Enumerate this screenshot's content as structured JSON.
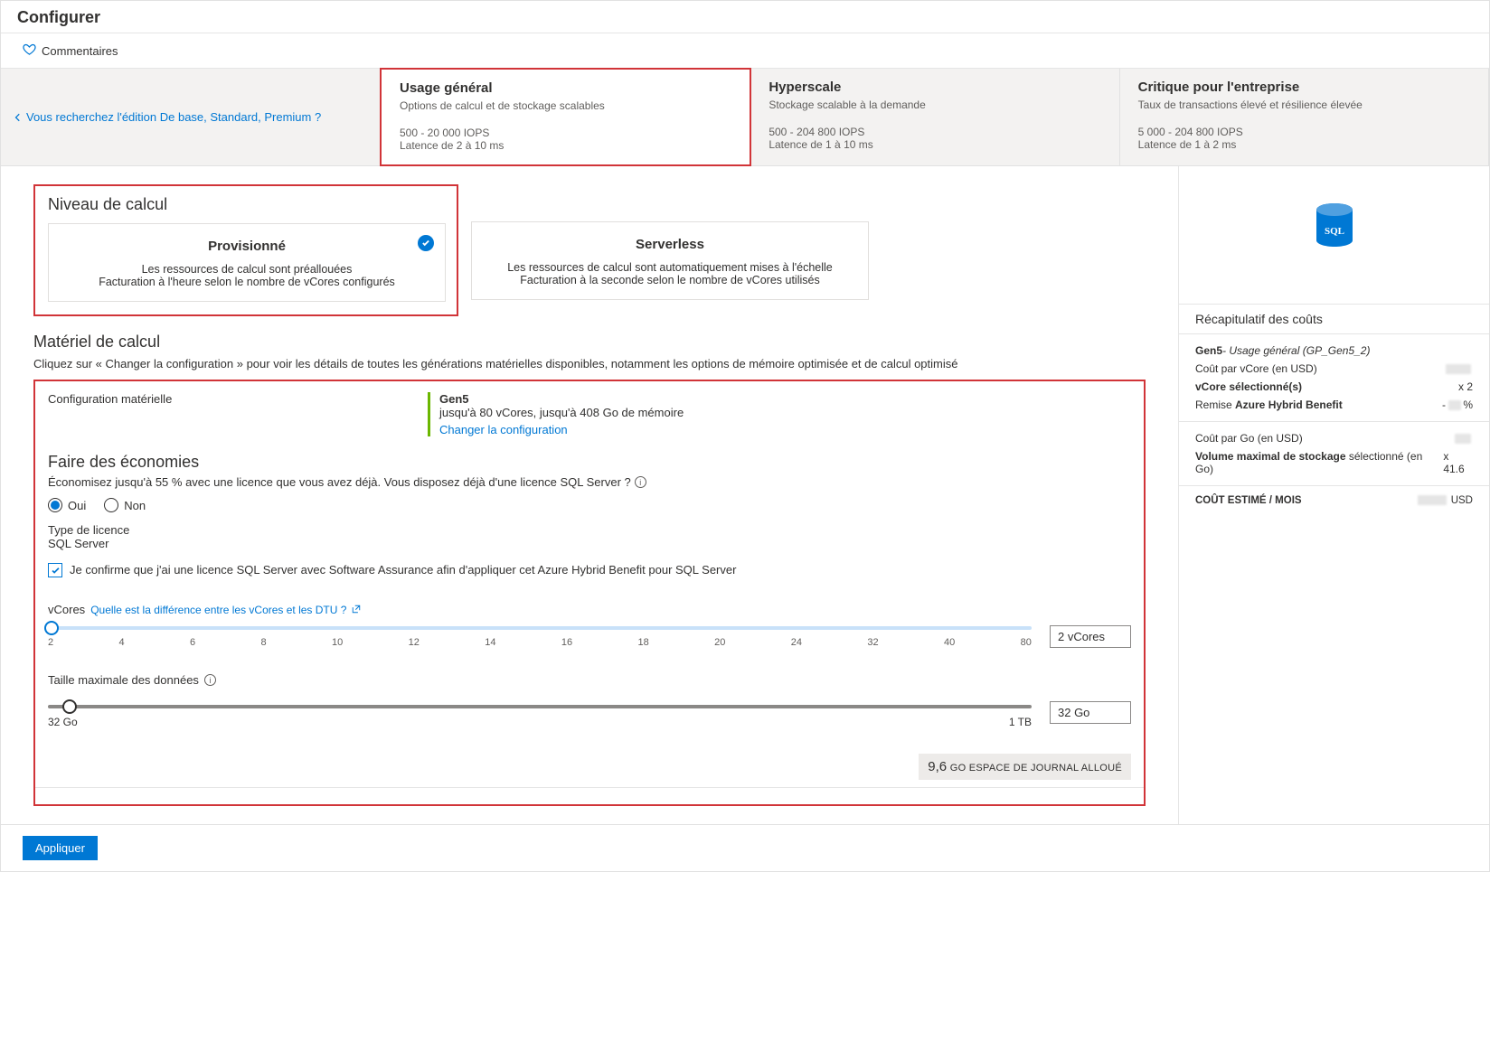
{
  "header": {
    "title": "Configurer"
  },
  "feedback": {
    "label": "Commentaires"
  },
  "back_link": "Vous recherchez l'édition De base, Standard, Premium ?",
  "tiers": {
    "general": {
      "title": "Usage général",
      "sub": "Options de calcul et de stockage scalables",
      "iops": "500 - 20 000 IOPS",
      "latency": "Latence de 2 à 10 ms"
    },
    "hyperscale": {
      "title": "Hyperscale",
      "sub": "Stockage scalable à la demande",
      "iops": "500 - 204 800 IOPS",
      "latency": "Latence de 1 à 10 ms"
    },
    "critical": {
      "title": "Critique pour l'entreprise",
      "sub": "Taux de transactions élevé et résilience élevée",
      "iops": "5 000 - 204 800 IOPS",
      "latency": "Latence de 1 à 2 ms"
    }
  },
  "compute_tier": {
    "section_title": "Niveau de calcul",
    "provisioned": {
      "title": "Provisionné",
      "line1": "Les ressources de calcul sont préallouées",
      "line2": "Facturation à l'heure selon le nombre de vCores configurés"
    },
    "serverless": {
      "title": "Serverless",
      "line1": "Les ressources de calcul sont automatiquement mises à l'échelle",
      "line2": "Facturation à la seconde selon le nombre de vCores utilisés"
    }
  },
  "hardware": {
    "section_title": "Matériel de calcul",
    "para": "Cliquez sur « Changer la configuration » pour voir les détails de toutes les générations matérielles disponibles, notamment les options de mémoire optimisée et de calcul optimisé",
    "label": "Configuration matérielle",
    "name": "Gen5",
    "desc": "jusqu'à 80 vCores, jusqu'à 408 Go de mémoire",
    "change_link": "Changer la configuration"
  },
  "savings": {
    "title": "Faire des économies",
    "para": "Économisez jusqu'à 55 % avec une licence que vous avez déjà. Vous disposez déjà d'une licence SQL Server ?",
    "yes": "Oui",
    "no": "Non",
    "license_type_label": "Type de licence",
    "license_type_value": "SQL Server",
    "confirm": "Je confirme que j'ai une licence SQL Server avec Software Assurance afin d'appliquer cet Azure Hybrid Benefit pour SQL Server"
  },
  "vcores": {
    "label": "vCores",
    "help_link": "Quelle est la différence entre les vCores et les DTU ?",
    "value_display": "2 vCores",
    "ticks": [
      "2",
      "4",
      "6",
      "8",
      "10",
      "12",
      "14",
      "16",
      "18",
      "20",
      "24",
      "32",
      "40",
      "80"
    ]
  },
  "datasize": {
    "label": "Taille maximale des données",
    "value_display": "32 Go",
    "min_label": "32 Go",
    "max_label": "1 TB"
  },
  "log_space": {
    "value": "9,6",
    "label": "GO ESPACE DE JOURNAL ALLOUÉ"
  },
  "cost": {
    "title": "Récapitulatif des coûts",
    "gen_line_prefix": "Gen5",
    "gen_line_suffix": "- Usage général (GP_Gen5_2)",
    "cost_per_vcore": "Coût par vCore (en USD)",
    "vcore_selected": "vCore sélectionné(s)",
    "vcore_selected_val": "x 2",
    "hybrid_label_pre": "Remise ",
    "hybrid_label_bold": "Azure Hybrid Benefit",
    "hybrid_val_suffix": "%",
    "cost_per_go": "Coût par Go (en USD)",
    "storage_label_pre": "Volume maximal de stockage ",
    "storage_label_suf": "sélectionné (en Go)",
    "storage_val": "x 41.6",
    "est_label": "COÛT ESTIMÉ / MOIS",
    "est_suffix": " USD"
  },
  "chart_data": {
    "vcores_slider": {
      "type": "slider",
      "ticks": [
        2,
        4,
        6,
        8,
        10,
        12,
        14,
        16,
        18,
        20,
        24,
        32,
        40,
        80
      ],
      "value": 2
    },
    "data_size_slider": {
      "type": "slider",
      "min_label": "32 Go",
      "max_label": "1 TB",
      "value_label": "32 Go"
    }
  },
  "footer": {
    "apply": "Appliquer"
  }
}
